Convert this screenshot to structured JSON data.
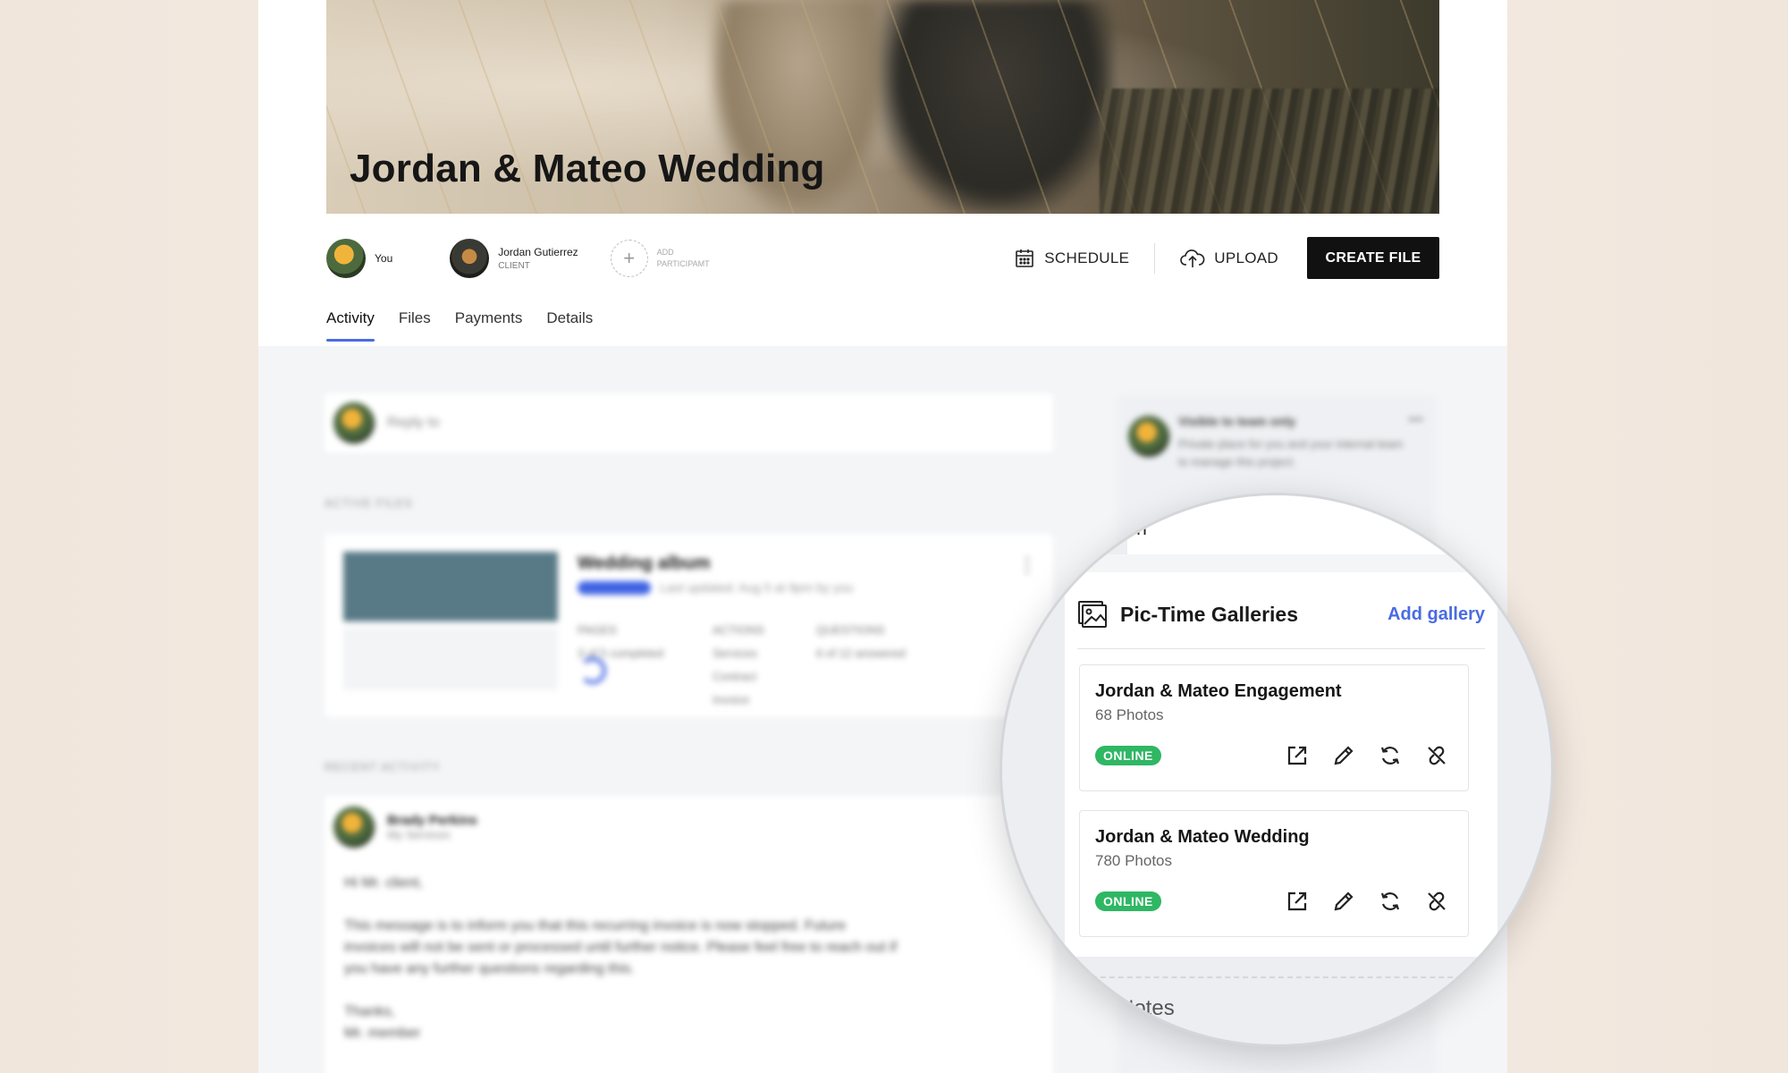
{
  "project": {
    "title": "Jordan & Mateo Wedding"
  },
  "participants": {
    "you_label": "You",
    "client_name": "Jordan Gutierrez",
    "client_role": "CLIENT",
    "add_label_line1": "ADD",
    "add_label_line2": "PARTICIPAMT"
  },
  "actions": {
    "schedule": "SCHEDULE",
    "upload": "UPLOAD",
    "create_file": "CREATE FILE"
  },
  "tabs": [
    "Activity",
    "Files",
    "Payments",
    "Details"
  ],
  "reply": {
    "placeholder": "Reply to"
  },
  "sections": {
    "active_files": "ACTIVE FILES",
    "recent_activity": "RECENT ACTIVITY"
  },
  "file_card": {
    "title": "Wedding album",
    "sub": "Last updated: Aug 5 at 9pm by you",
    "col1_head": "PAGES",
    "col1_val": "3 of 5 completed",
    "col2_head": "ACTIONS",
    "col2_items": [
      "Services",
      "Contract",
      "Invoice"
    ],
    "col3_head": "QUESTIONS",
    "col3_val": "6 of 12 answered"
  },
  "activity": {
    "author": "Brady Perkins",
    "author_sub": "My Services",
    "greeting": "Hi Mr. client,",
    "body": "This message is to inform you that this recurring invoice is now stopped. Future invoices will not be sent or processed until further notice. Please feel free to reach out if you have any further questions regarding this.",
    "signoff1": "Thanks,",
    "signoff2": "Mr. member"
  },
  "side": {
    "visibility": "Visible to team only",
    "visibility_sub": "Private place for you and your internal team to manage this project."
  },
  "lens": {
    "search_text": "wn",
    "notes_label": "Notes",
    "galleries": {
      "title": "Pic-Time Galleries",
      "add_label": "Add gallery",
      "items": [
        {
          "name": "Jordan & Mateo Engagement",
          "count": "68 Photos",
          "status": "ONLINE"
        },
        {
          "name": "Jordan & Mateo Wedding",
          "count": "780 Photos",
          "status": "ONLINE"
        }
      ]
    }
  },
  "colors": {
    "accent": "#4a6be2",
    "online": "#2fb764",
    "primary_button": "#111111"
  },
  "icons": {
    "schedule": "calendar-icon",
    "upload": "cloud-upload-icon",
    "gallery": "image-icon",
    "open": "external-link-icon",
    "edit": "pencil-icon",
    "sync": "refresh-icon",
    "unlink": "unlink-icon"
  }
}
